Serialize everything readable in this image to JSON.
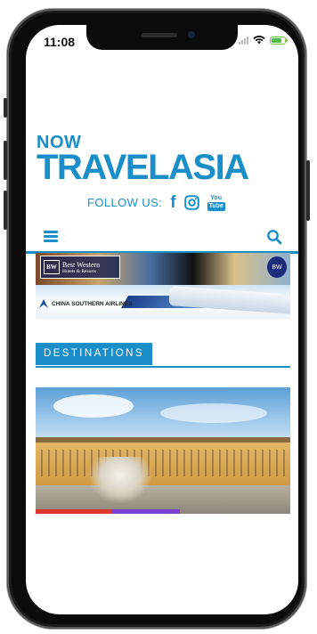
{
  "status_bar": {
    "time": "11:08"
  },
  "logo": {
    "now": "NOW",
    "main": "TRAVELASIA"
  },
  "follow": {
    "label": "FOLLOW US:",
    "facebook_glyph": "f",
    "youtube_top": "You",
    "youtube_bottom": "Tube"
  },
  "nav": {
    "menu_icon": "hamburger-menu-icon",
    "search_icon": "search-icon"
  },
  "ads": {
    "banner1": {
      "brand": "Best Western",
      "tagline": "Hotels & Resorts",
      "logo": "BW"
    },
    "banner2": {
      "airline": "CHINA SOUTHERN AIRLINES"
    }
  },
  "section": {
    "title": "DESTINATIONS"
  },
  "hero": {
    "category_colors": [
      "#d9352b",
      "#7b3fd1"
    ]
  },
  "colors": {
    "brand": "#1a8ec8",
    "battery": "#4cc04a"
  }
}
